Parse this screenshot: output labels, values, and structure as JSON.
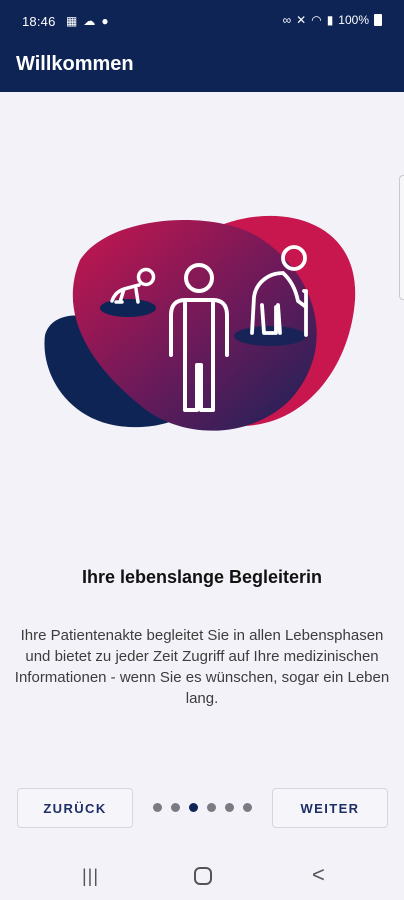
{
  "status_bar": {
    "time": "18:46",
    "left_icons": [
      "calendar-icon",
      "cloud-icon",
      "pin-icon"
    ],
    "right_icons": [
      "link-icon",
      "mute-icon",
      "wifi-icon",
      "signal-icon"
    ],
    "battery": "100%"
  },
  "app_bar": {
    "title": "Willkommen"
  },
  "illustration": {
    "description_icons": [
      "baby-icon",
      "adult-icon",
      "elderly-icon"
    ],
    "colors": {
      "navy": "#0d2455",
      "magenta": "#c8164e"
    }
  },
  "content": {
    "heading": "Ihre lebenslange Begleiterin",
    "body": "Ihre Patientenakte begleitet Sie in allen Lebensphasen und bietet zu jeder Zeit Zugriff auf Ihre medizinischen Informationen - wenn Sie es wünschen, sogar ein Leben lang."
  },
  "navigation": {
    "back_label": "ZURÜCK",
    "next_label": "WEITER",
    "page_count": 6,
    "current_page": 3
  },
  "system_nav": {
    "recents": "|||",
    "back": "<"
  }
}
